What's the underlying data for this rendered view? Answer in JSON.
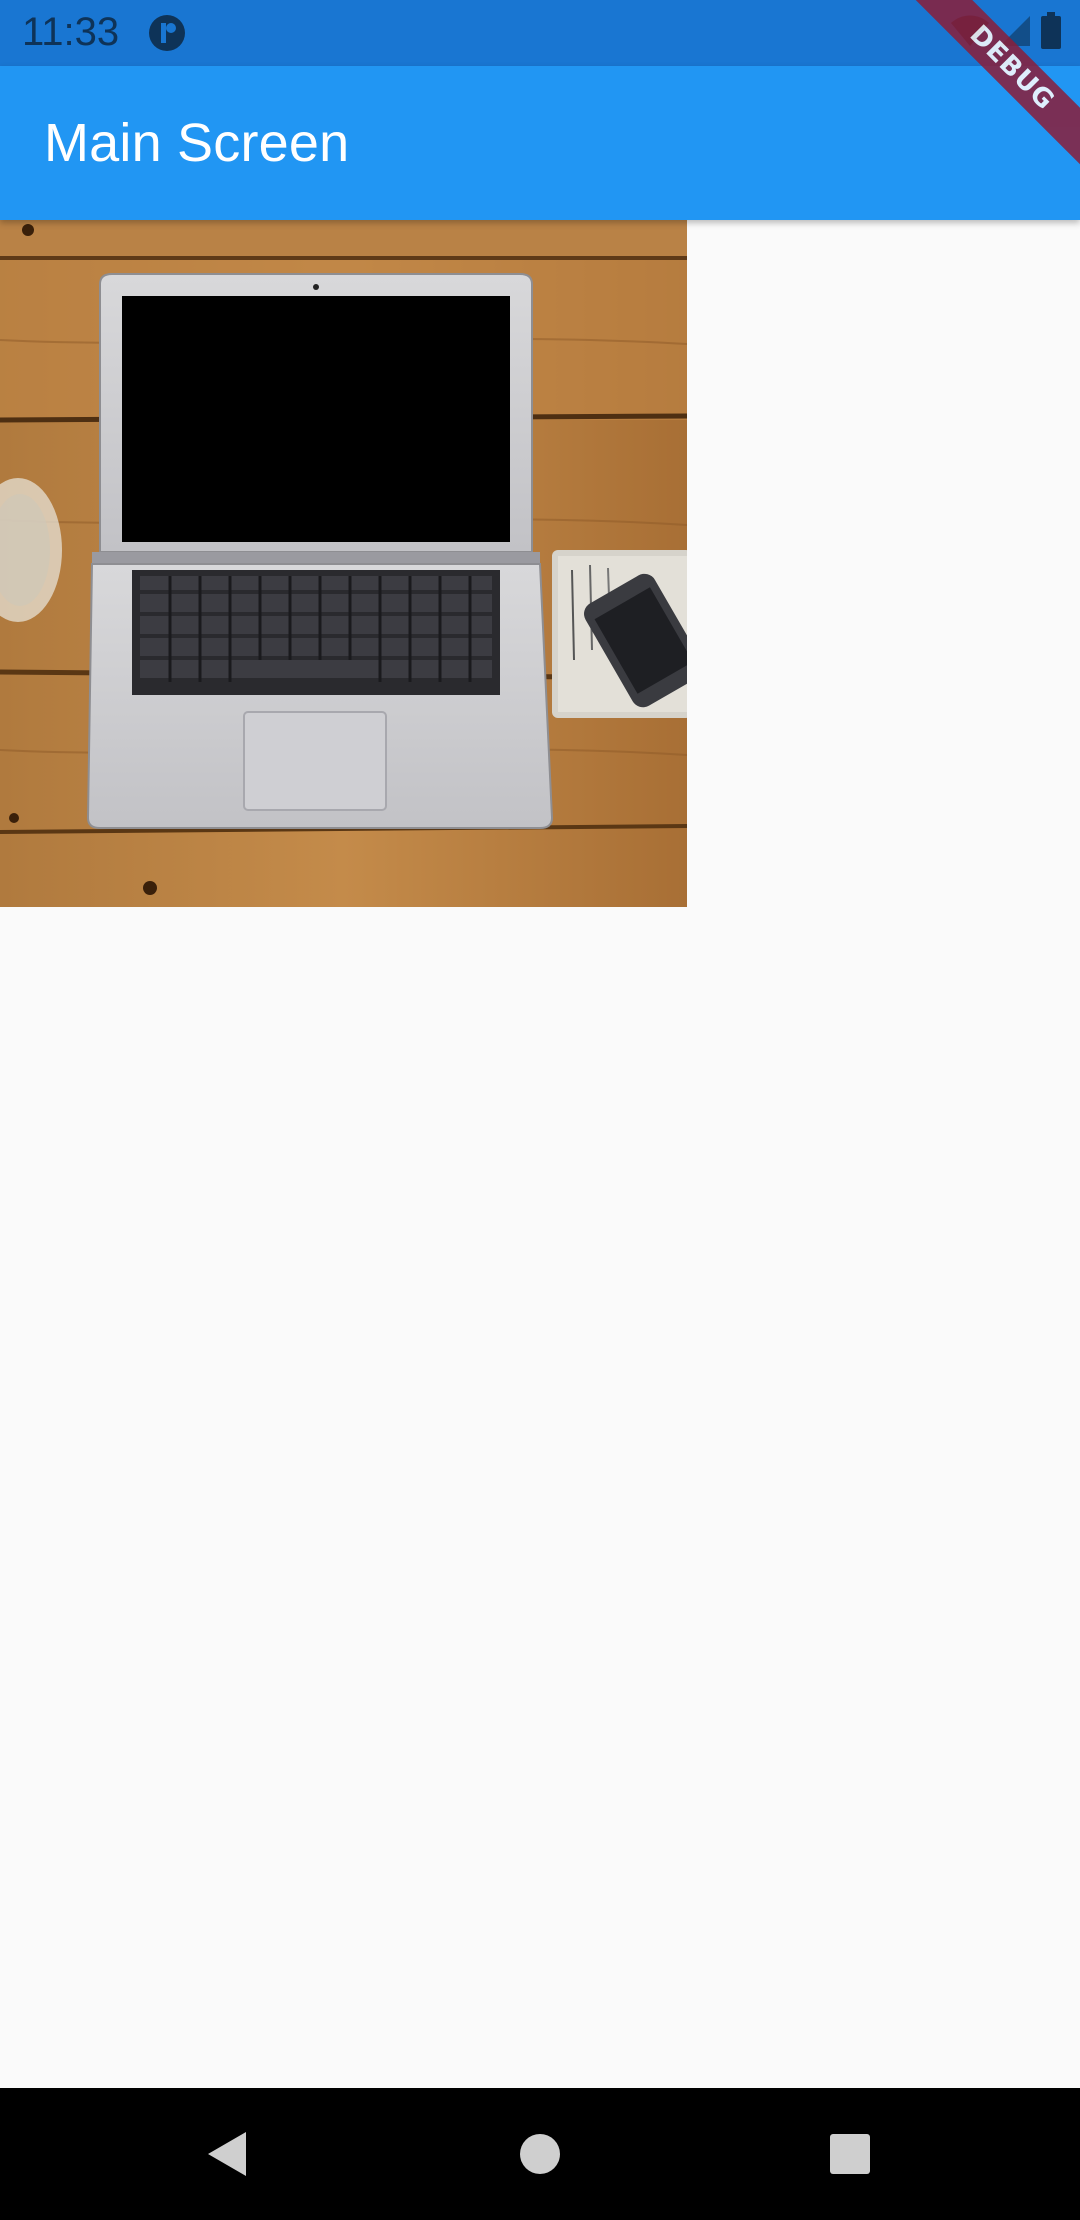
{
  "status_bar": {
    "time": "11:33",
    "icons": [
      "app-notification-icon",
      "wifi-icon",
      "signal-icon",
      "battery-icon"
    ]
  },
  "app_bar": {
    "title": "Main Screen",
    "color": "#2196f3"
  },
  "debug_banner": {
    "label": "DEBUG"
  },
  "content": {
    "image_subject": "laptop on wooden desk with glass, notebook and phone"
  },
  "nav_bar": {
    "buttons": [
      "back-icon",
      "home-icon",
      "recents-icon"
    ]
  }
}
